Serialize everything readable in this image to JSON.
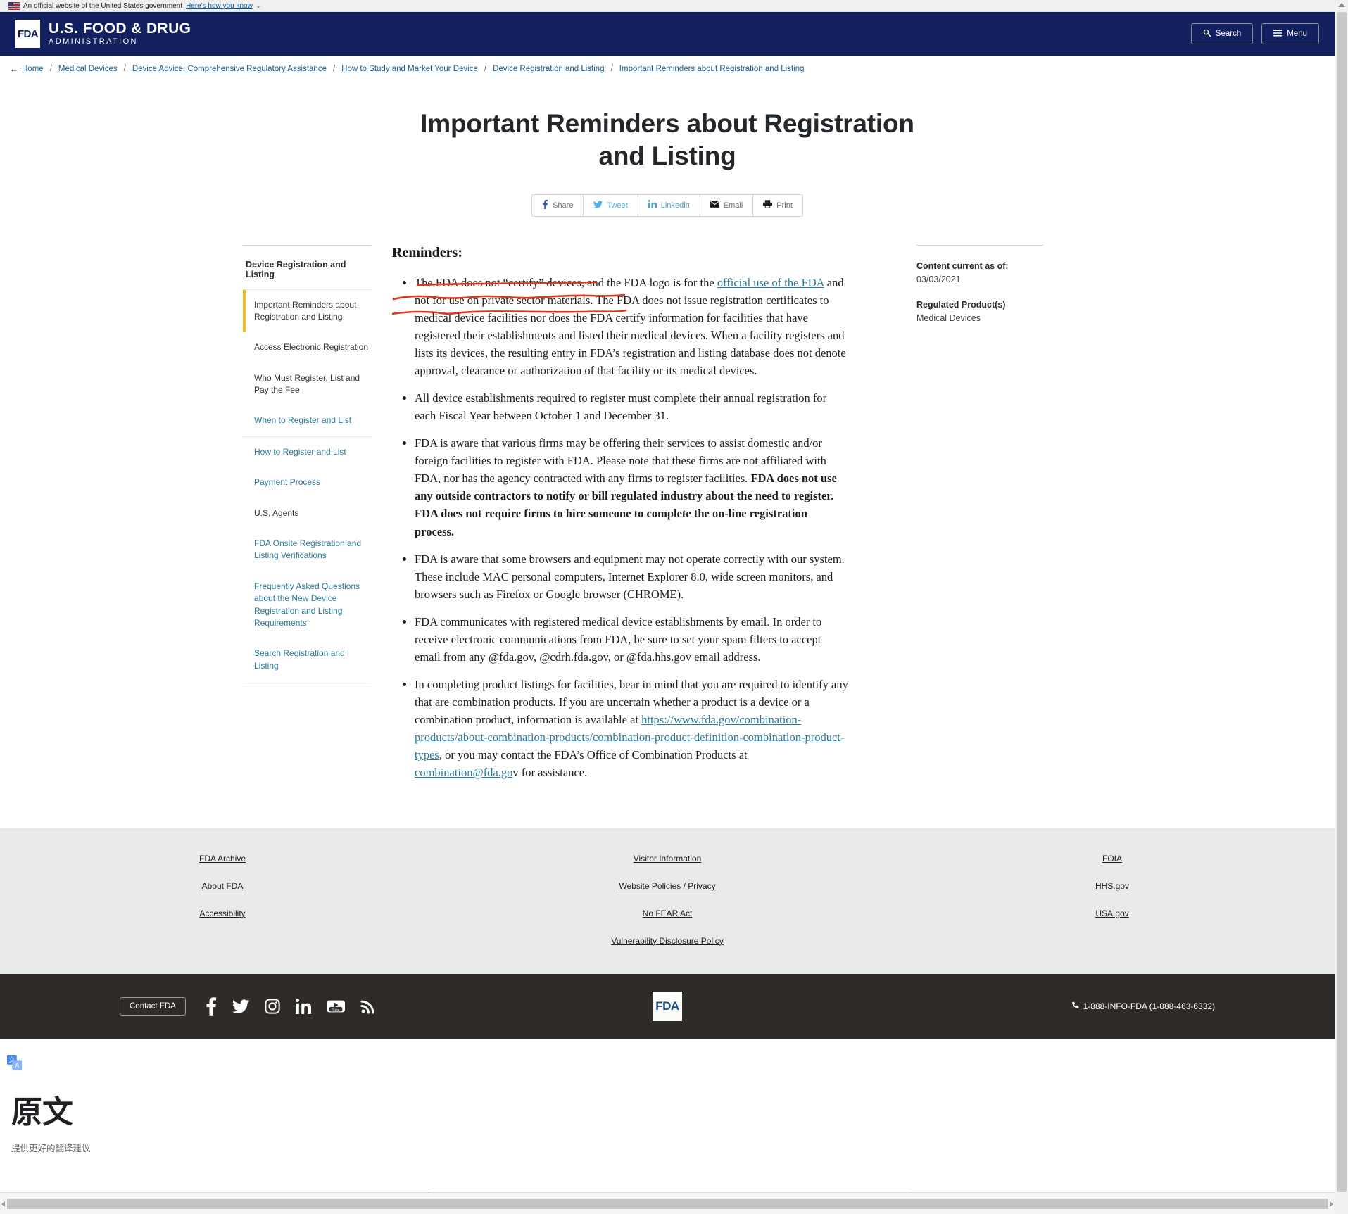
{
  "gov_banner": {
    "text": "An official website of the United States government",
    "link": "Here's how you know",
    "caret": "⌄"
  },
  "header": {
    "logo_mark": "FDA",
    "logo_line1": "U.S. FOOD & DRUG",
    "logo_line2": "ADMINISTRATION",
    "search_label": "Search",
    "menu_label": "Menu",
    "search_icon": "search-icon",
    "menu_icon": "hamburger-icon"
  },
  "breadcrumb": {
    "back_arrow": "←",
    "separator": "/",
    "items": [
      "Home",
      "Medical Devices",
      "Device Advice: Comprehensive Regulatory Assistance",
      "How to Study and Market Your Device",
      "Device Registration and Listing",
      "Important Reminders about Registration and Listing"
    ]
  },
  "page": {
    "title": "Important Reminders about Registration and Listing"
  },
  "share": {
    "buttons": [
      {
        "label": "Share",
        "icon": "facebook-icon"
      },
      {
        "label": "Tweet",
        "icon": "twitter-icon"
      },
      {
        "label": "Linkedin",
        "icon": "linkedin-icon"
      },
      {
        "label": "Email",
        "icon": "envelope-icon"
      },
      {
        "label": "Print",
        "icon": "printer-icon"
      }
    ]
  },
  "sidebar": {
    "heading": "Device Registration and Listing",
    "items": [
      {
        "label": "Important Reminders about Registration and Listing",
        "state": "active"
      },
      {
        "label": "Access Electronic Registration",
        "state": "plain"
      },
      {
        "label": "Who Must Register, List and Pay the Fee",
        "state": "plain"
      },
      {
        "label": "When to Register and List",
        "state": "link"
      },
      {
        "label": "How to Register and List",
        "state": "link-bordered"
      },
      {
        "label": "Payment Process",
        "state": "link"
      },
      {
        "label": "U.S. Agents",
        "state": "plain"
      },
      {
        "label": "FDA Onsite Registration and Listing Verifications",
        "state": "link"
      },
      {
        "label": "Frequently Asked Questions about the New Device Registration and Listing Requirements",
        "state": "link"
      },
      {
        "label": "Search Registration and Listing",
        "state": "link"
      }
    ]
  },
  "main": {
    "heading": "Reminders:",
    "bullets": {
      "b1": {
        "p1": "The FDA does not “certify” devices, and the FDA logo is for the ",
        "link1": "official use of the FDA",
        "p2": " and not for use on private sector materials. The FDA does not issue registration certificates to medical device facilities nor does the FDA certify information for facilities that have registered their establishments and listed their medical devices. When a facility registers and lists its devices, the resulting entry in FDA’s registration and listing database does not denote approval, clearance or authorization of that facility or its medical devices."
      },
      "b2": "All device establishments required to register must complete their annual registration for each Fiscal Year between October 1 and December 31.",
      "b3": {
        "p1": "FDA is aware that various firms may be offering their services to assist domestic and/or foreign facilities to register with FDA. Please note that these firms are not affiliated with FDA, nor has the agency contracted with any firms to register facilities. ",
        "bold": "FDA does not use any outside contractors to notify or bill regulated industry about the need to register. FDA does not require firms to hire someone to complete the on-line registration process."
      },
      "b4": "FDA is aware that some browsers and equipment may not operate correctly with our system. These include MAC personal computers, Internet Explorer 8.0, wide screen monitors, and browsers such as Firefox or Google browser (CHROME).",
      "b5": "FDA communicates with registered medical device establishments by email. In order to receive electronic communications from FDA, be sure to set your spam filters to accept email from any @fda.gov, @cdrh.fda.gov, or @fda.hhs.gov email address.",
      "b6": {
        "p1": "In completing product listings for facilities, bear in mind that you are required to identify any that are combination products.  If you are uncertain whether a product is a device or a combination product, information is available at ",
        "link1": "https://www.fda.gov/combination-products/about-combination-products/combination-product-definition-combination-product-types",
        "p2": ", or you may contact the FDA’s Office of Combination Products at ",
        "link2": "combination@fda.go",
        "p3": "v for assistance."
      }
    }
  },
  "annotation": {
    "color": "#d93a1e",
    "note": "hand-drawn red underline"
  },
  "meta": {
    "current_label": "Content current as of:",
    "current_value": "03/03/2021",
    "product_label": "Regulated Product(s)",
    "product_value": "Medical Devices"
  },
  "footer": {
    "col1": [
      "FDA Archive",
      "About FDA",
      "Accessibility"
    ],
    "col2": [
      "Visitor Information",
      "Website Policies / Privacy",
      "No FEAR Act",
      "Vulnerability Disclosure Policy"
    ],
    "col3": [
      "FOIA",
      "HHS.gov",
      "USA.gov"
    ],
    "contact_label": "Contact FDA",
    "social": [
      "facebook-icon",
      "twitter-icon",
      "instagram-icon",
      "linkedin-icon",
      "youtube-icon",
      "rss-icon"
    ],
    "logo_mark": "FDA",
    "phone": "1-888-INFO-FDA (1-888-463-6332)",
    "phone_icon": "phone-icon"
  },
  "translate_panel": {
    "icon": "google-translate-icon",
    "title": "原文",
    "subtitle": "提供更好的翻译建议"
  },
  "colors": {
    "fda_navy": "#13205f",
    "link_blue": "#2b7a9b",
    "accent_yellow": "#f4bd19",
    "annotation_red": "#d93a1e",
    "footer_dark": "#2e2b28",
    "footer_light": "#e9eaea"
  }
}
